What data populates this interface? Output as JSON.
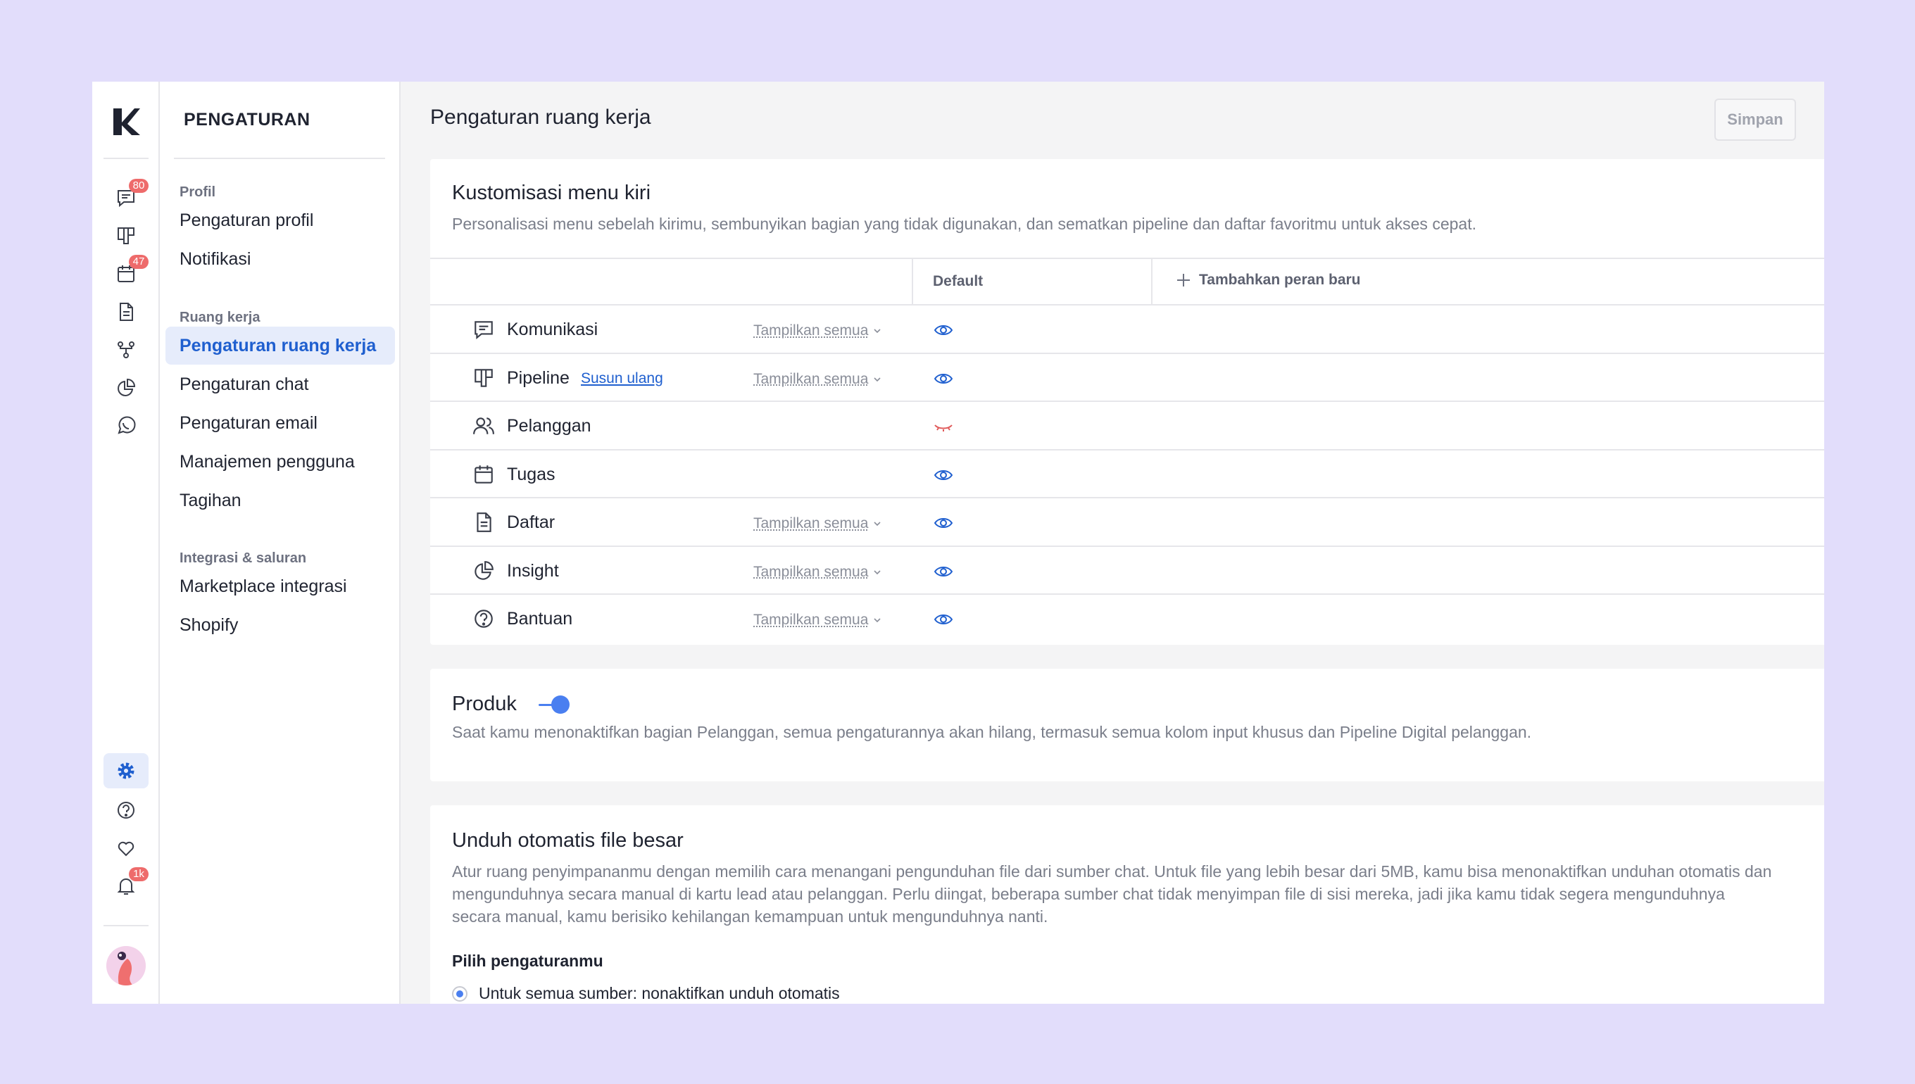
{
  "rail": {
    "badges": {
      "chat": "80",
      "tasks": "47",
      "notifications": "1k"
    }
  },
  "settings_nav": {
    "title": "PENGATURAN",
    "groups": [
      {
        "label": "Profil",
        "items": [
          "Pengaturan profil",
          "Notifikasi"
        ]
      },
      {
        "label": "Ruang kerja",
        "items": [
          "Pengaturan ruang kerja",
          "Pengaturan chat",
          "Pengaturan email",
          "Manajemen pengguna",
          "Tagihan"
        ]
      },
      {
        "label": "Integrasi & saluran",
        "items": [
          "Marketplace integrasi",
          "Shopify"
        ]
      }
    ],
    "active_item": "Pengaturan ruang kerja"
  },
  "header": {
    "title": "Pengaturan ruang kerja",
    "save_label": "Simpan"
  },
  "menu_card": {
    "title": "Kustomisasi menu kiri",
    "description": "Personalisasi menu sebelah kirimu, sembunyikan bagian yang tidak digunakan, dan sematkan pipeline dan daftar favoritmu untuk akses cepat.",
    "col_default": "Default",
    "col_add": "Tambahkan peran baru",
    "rows": [
      {
        "label": "Komunikasi",
        "icon": "chat-icon",
        "select": "Tampilkan semua",
        "visible": true
      },
      {
        "label": "Pipeline",
        "icon": "pipeline-icon",
        "link": "Susun ulang",
        "select": "Tampilkan semua",
        "visible": true
      },
      {
        "label": "Pelanggan",
        "icon": "users-icon",
        "visible": false
      },
      {
        "label": "Tugas",
        "icon": "calendar-icon",
        "visible": true
      },
      {
        "label": "Daftar",
        "icon": "document-icon",
        "select": "Tampilkan semua",
        "visible": true
      },
      {
        "label": "Insight",
        "icon": "pie-chart-icon",
        "select": "Tampilkan semua",
        "visible": true
      },
      {
        "label": "Bantuan",
        "icon": "help-icon",
        "select": "Tampilkan semua",
        "visible": true
      }
    ]
  },
  "product_card": {
    "title": "Produk",
    "enabled": true,
    "description": "Saat kamu menonaktifkan bagian Pelanggan, semua pengaturannya akan hilang, termasuk semua kolom input khusus dan Pipeline Digital pelanggan."
  },
  "download_card": {
    "title": "Unduh otomatis file besar",
    "description": "Atur ruang penyimpananmu dengan memilih cara menangani pengunduhan file dari sumber chat. Untuk file yang lebih besar dari 5MB, kamu bisa menonaktifkan unduhan otomatis dan mengunduhnya secara manual di kartu lead atau pelanggan. Perlu diingat, beberapa sumber chat tidak menyimpan file di sisi mereka, jadi jika kamu tidak segera mengunduhnya secara manual, kamu berisiko kehilangan kemampuan untuk mengunduhnya nanti.",
    "subheading": "Pilih pengaturanmu",
    "option_1": "Untuk semua sumber: nonaktifkan unduh otomatis"
  },
  "colors": {
    "accent": "#1f5fcf",
    "toggle": "#4a7ff0",
    "badge": "#ee6b6b",
    "hidden_eye": "#e05a5a"
  }
}
